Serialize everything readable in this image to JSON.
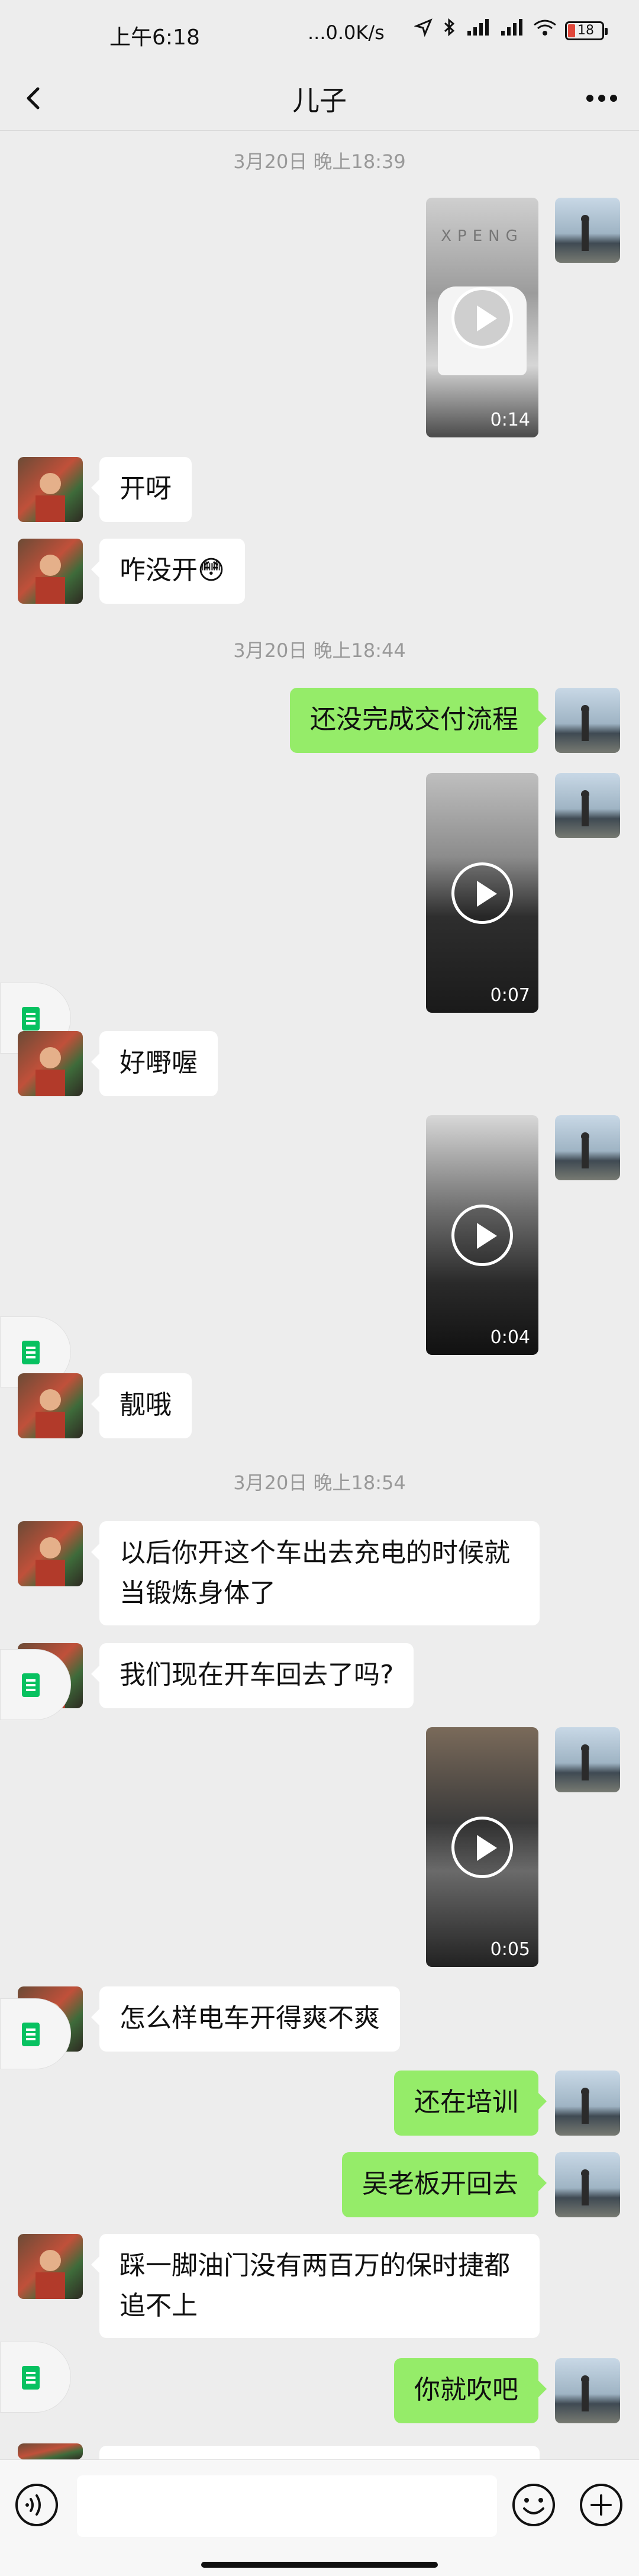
{
  "status": {
    "time": "上午6:18",
    "network": "...0.0K/s",
    "battery": "18"
  },
  "nav": {
    "title": "儿子"
  },
  "timestamps": [
    "3月20日 晚上18:39",
    "3月20日 晚上18:44",
    "3月20日 晚上18:54"
  ],
  "messages": {
    "m1": "开呀",
    "m2": "咋没开😳",
    "m3": "还没完成交付流程",
    "m4": "好嘢喔",
    "m5": "靓哦",
    "m6": "以后你开这个车出去充电的时候就当锻炼身体了",
    "m7": "我们现在开车回去了吗?",
    "m8": "怎么样电车开得爽不爽",
    "m9": "还在培训",
    "m10": "吴老板开回去",
    "m11": "踩一脚油门没有两百万的保时捷都追不上",
    "m12": "你就吹吧"
  },
  "videos": {
    "v1": "0:14",
    "v2": "0:07",
    "v3": "0:04",
    "v4": "0:05"
  },
  "video_overlay": {
    "brand": "XPENG"
  },
  "icons": {
    "back": "chevron-left-icon",
    "more": "more-dots-icon",
    "voice": "voice-icon",
    "emoji": "emoji-icon",
    "plus": "plus-icon"
  },
  "colors": {
    "outgoing_bubble": "#95EC69",
    "incoming_bubble": "#FFFFFF",
    "background": "#EDEDED"
  }
}
